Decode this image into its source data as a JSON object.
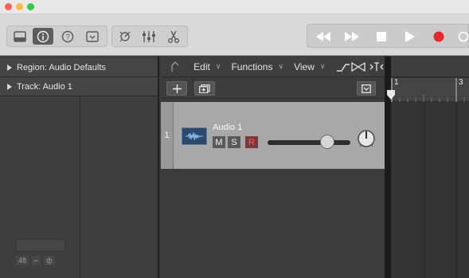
{
  "window": {
    "traffic_lights": {
      "close": "#fc605c",
      "minimize": "#fdbc40",
      "zoom": "#34c84a"
    }
  },
  "control_bar": {
    "left_buttons": [
      "library-icon",
      "inspector-icon",
      "help-icon",
      "toolbar-icon"
    ],
    "mid_buttons": [
      "smart-controls-icon",
      "mixer-icon",
      "editors-icon"
    ],
    "transport": [
      "rewind-icon",
      "fast-forward-icon",
      "stop-icon",
      "play-icon",
      "record-icon",
      "cycle-icon"
    ]
  },
  "inspector": {
    "region_label": "Region: Audio Defaults",
    "track_label": "Track: Audio 1",
    "mini_a": "48",
    "mini_b": "⌐",
    "mini_c": "ф"
  },
  "tracks_area": {
    "menus": [
      {
        "label": "Edit"
      },
      {
        "label": "Functions"
      },
      {
        "label": "View"
      }
    ],
    "track": {
      "number": "1",
      "name": "Audio 1",
      "mute": "M",
      "solo": "S",
      "record": "R",
      "volume_level": 0.72
    }
  },
  "ruler": {
    "bars": [
      "1",
      "3"
    ]
  },
  "colors": {
    "record_red": "#e8262a",
    "track_icon_blue": "#2d4a6b"
  }
}
